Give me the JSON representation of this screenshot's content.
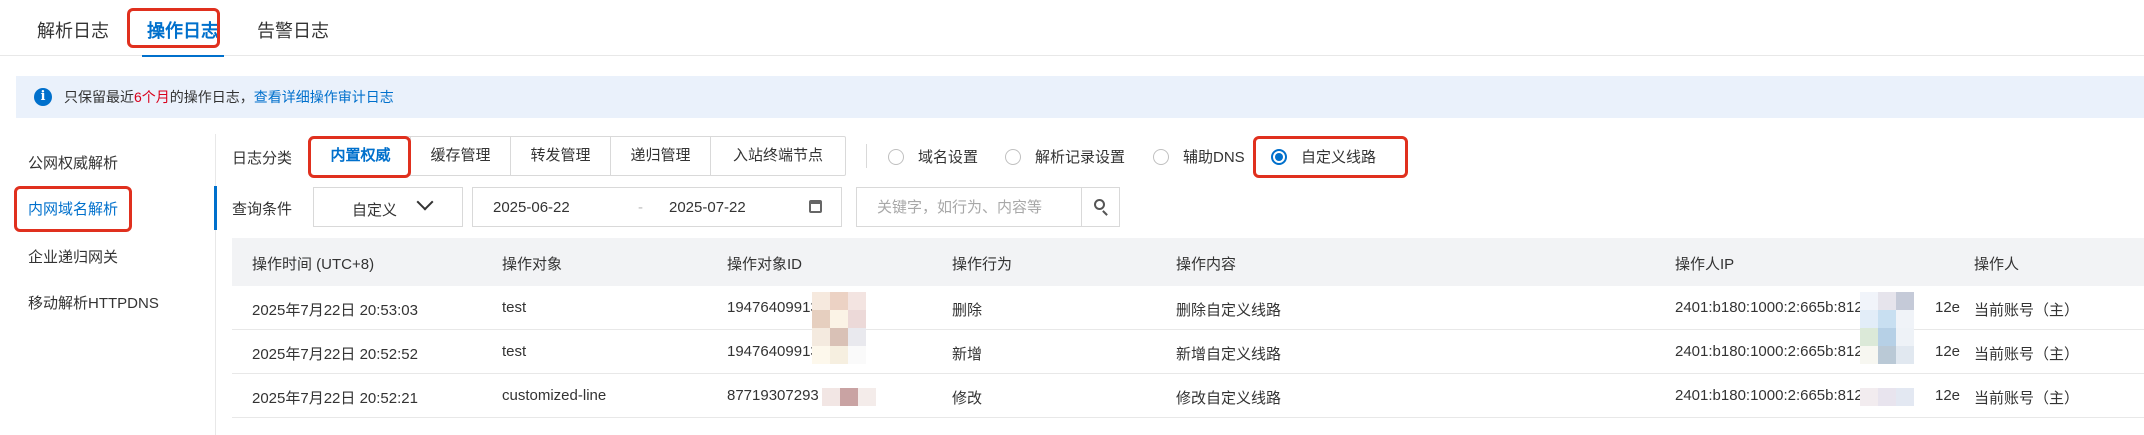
{
  "top_tabs": {
    "items": [
      {
        "label": "解析日志"
      },
      {
        "label": "操作日志"
      },
      {
        "label": "告警日志"
      }
    ],
    "active": "操作日志"
  },
  "notice": {
    "prefix": "只保留最近",
    "highlight": "6个月",
    "suffix": "的操作日志，",
    "link": "查看详细操作审计日志"
  },
  "sidebar": {
    "items": [
      {
        "label": "公网权威解析"
      },
      {
        "label": "内网域名解析"
      },
      {
        "label": "企业递归网关"
      },
      {
        "label": "移动解析HTTPDNS"
      }
    ],
    "active": "内网域名解析"
  },
  "filters": {
    "category_label": "日志分类",
    "categories": [
      {
        "label": "内置权威"
      },
      {
        "label": "缓存管理"
      },
      {
        "label": "转发管理"
      },
      {
        "label": "递归管理"
      },
      {
        "label": "入站终端节点"
      }
    ],
    "active_category": "内置权威",
    "radios": [
      {
        "label": "域名设置"
      },
      {
        "label": "解析记录设置"
      },
      {
        "label": "辅助DNS"
      },
      {
        "label": "自定义线路"
      }
    ],
    "checked_radio": "自定义线路",
    "query_label": "查询条件",
    "range_select": "自定义",
    "date_start": "2025-06-22",
    "date_end": "2025-07-22",
    "search_placeholder": "关键字，如行为、内容等"
  },
  "table": {
    "columns": [
      "操作时间 (UTC+8)",
      "操作对象",
      "操作对象ID",
      "操作行为",
      "操作内容",
      "操作人IP",
      "操作人"
    ],
    "rows": [
      {
        "time": "2025年7月22日 20:53:03",
        "object": "test",
        "object_id": "19476409913",
        "action": "删除",
        "content": "删除自定义线路",
        "ip_prefix": "2401:b180:1000:2:665b:812",
        "ip_suffix": "12e",
        "operator": "当前账号（主）"
      },
      {
        "time": "2025年7月22日 20:52:52",
        "object": "test",
        "object_id": "19476409913",
        "action": "新增",
        "content": "新增自定义线路",
        "ip_prefix": "2401:b180:1000:2:665b:812",
        "ip_suffix": "12e",
        "operator": "当前账号（主）"
      },
      {
        "time": "2025年7月22日 20:52:21",
        "object": "customized-line",
        "object_id": "87719307293",
        "action": "修改",
        "content": "修改自定义线路",
        "ip_prefix": "2401:b180:1000:2:665b:812",
        "ip_suffix": "12e",
        "operator": "当前账号（主）"
      }
    ]
  },
  "colors": {
    "accent": "#0070cc",
    "highlight_box": "#e0301e",
    "notice_bg": "#eaf1fb",
    "header_bg": "#f2f3f5",
    "warning_text": "#d9001b"
  },
  "icons": {
    "notice": "info-icon",
    "select": "chevron-down-icon",
    "date": "calendar-icon",
    "search": "search-icon"
  }
}
